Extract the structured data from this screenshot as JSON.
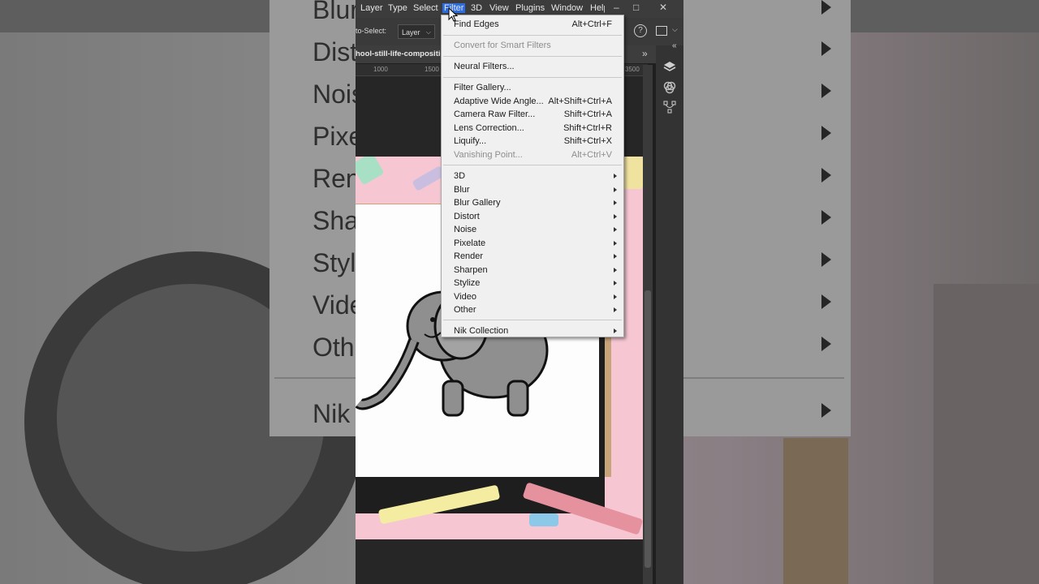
{
  "menubar": {
    "items": [
      "Layer",
      "Type",
      "Select",
      "Filter",
      "3D",
      "View",
      "Plugins",
      "Window",
      "Help"
    ],
    "active_item": "Filter",
    "window_controls": [
      "–",
      "□",
      "✕"
    ]
  },
  "options_bar": {
    "auto_select_label": "to-Select:",
    "auto_select_value": "Layer"
  },
  "document_tab": {
    "title": "hool-still-life-compositio"
  },
  "ruler": {
    "ticks": [
      "1000",
      "1500",
      "3500"
    ]
  },
  "filter_menu": {
    "last_filter": {
      "label": "Find Edges",
      "shortcut": "Alt+Ctrl+F"
    },
    "convert_smart": {
      "label": "Convert for Smart Filters"
    },
    "neural": {
      "label": "Neural Filters..."
    },
    "group2": [
      {
        "label": "Filter Gallery...",
        "shortcut": ""
      },
      {
        "label": "Adaptive Wide Angle...",
        "shortcut": "Alt+Shift+Ctrl+A"
      },
      {
        "label": "Camera Raw Filter...",
        "shortcut": "Shift+Ctrl+A"
      },
      {
        "label": "Lens Correction...",
        "shortcut": "Shift+Ctrl+R"
      },
      {
        "label": "Liquify...",
        "shortcut": "Shift+Ctrl+X"
      },
      {
        "label": "Vanishing Point...",
        "shortcut": "Alt+Ctrl+V"
      }
    ],
    "submenus": [
      "3D",
      "Blur",
      "Blur Gallery",
      "Distort",
      "Noise",
      "Pixelate",
      "Render",
      "Sharpen",
      "Stylize",
      "Video",
      "Other"
    ],
    "plugins": [
      "Nik Collection"
    ]
  },
  "background_echo": {
    "labels": [
      "Blur",
      "Dist",
      "Nois",
      "Pixe",
      "Ren",
      "Sha",
      "Styl",
      "Vide",
      "Oth",
      "Nik"
    ]
  },
  "colors": {
    "menubar": "#3c3c3c",
    "menu_bg": "#f0f0f0",
    "active_highlight": "#2d6cdf",
    "photo_pink": "#f6c7d3"
  }
}
